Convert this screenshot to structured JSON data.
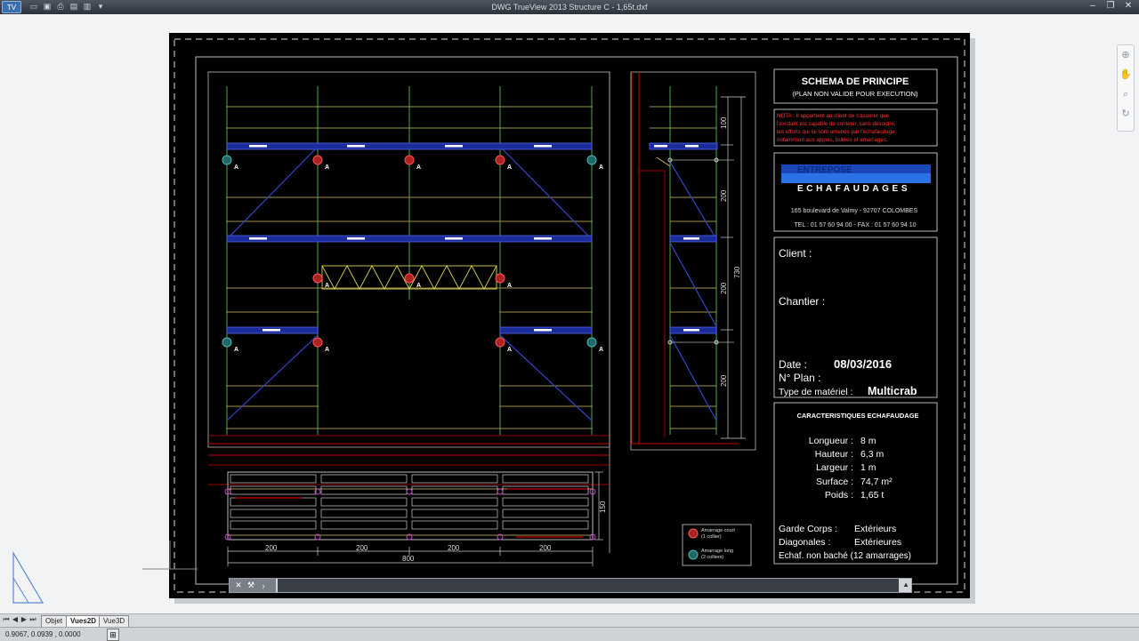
{
  "window": {
    "title": "DWG TrueView 2013    Structure C - 1,65t.dxf",
    "app_button": "TV"
  },
  "quick_access": [
    "open-icon",
    "save-icon",
    "print-icon",
    "plot-icon",
    "publish-icon",
    "dropdown-icon"
  ],
  "title_block": {
    "header": "SCHEMA DE PRINCIPE",
    "subheader": "(PLAN NON VALIDE POUR EXECUTION)",
    "nota": [
      "NOTA : Il appartient au client de s'assurer que",
      "l'existant est capable de contenir, sans désordre,",
      "les efforts qui lui sont amenés par l'échafaudage,",
      "notamment aux appuis, butées et amarrages."
    ],
    "company_line1": "ENTREPOSE",
    "company_line2": "ECHAFAUDAGES",
    "address": "165 boulevard de Valmy - 92707 COLOMBES",
    "phone": "TEL : 01 57 60 94 00 - FAX : 01 57 60 94 10",
    "client_label": "Client :",
    "chantier_label": "Chantier :",
    "date_label": "Date :",
    "date_value": "08/03/2016",
    "plan_label": "N° Plan :",
    "materiel_label": "Type de matériel :",
    "materiel_value": "Multicrab",
    "carac_title": "CARACTERISTIQUES ECHAFAUDAGE",
    "carac": [
      {
        "label": "Longueur :",
        "value": "8 m"
      },
      {
        "label": "Hauteur :",
        "value": "6,3 m"
      },
      {
        "label": "Largeur :",
        "value": "1 m"
      },
      {
        "label": "Surface :",
        "value": "74,7 m²"
      },
      {
        "label": "Poids :",
        "value": "1,65 t"
      }
    ],
    "garde_label": "Garde Corps :",
    "garde_value": "Extérieurs",
    "diag_label": "Diagonales :",
    "diag_value": "Extérieures",
    "bache": "Echaf. non baché (12 amarrages)"
  },
  "legend": {
    "court": "Amarrage court",
    "court_sub": "(1 collier)",
    "long": "Amarrage long",
    "long_sub": "(2 colliers)"
  },
  "dimensions": {
    "plan_bays": [
      "200",
      "200",
      "200",
      "200"
    ],
    "plan_total": "800",
    "plan_depth": "150",
    "side": [
      "100",
      "200",
      "200",
      "200"
    ],
    "side_total": "730",
    "tie_mark": "A"
  },
  "tabs": {
    "objet": "Objet",
    "vues2d": "Vues2D",
    "vue3d": "Vue3D"
  },
  "status": {
    "coords": "0.9067, 0.0939 , 0.0000"
  }
}
